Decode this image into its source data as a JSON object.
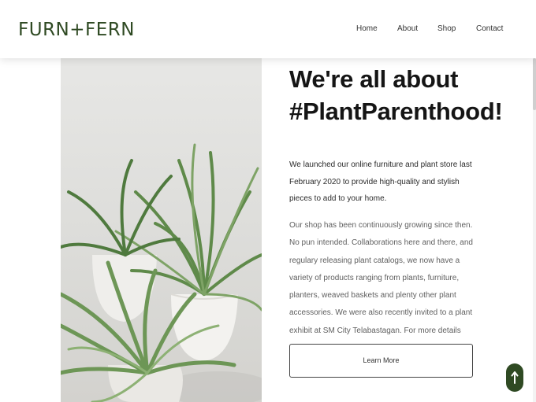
{
  "brand": {
    "logo_text": "FURN+FERN",
    "color": "#2f4a23"
  },
  "nav": {
    "items": [
      {
        "label": "Home"
      },
      {
        "label": "About"
      },
      {
        "label": "Shop"
      },
      {
        "label": "Contact"
      }
    ]
  },
  "about": {
    "heading_line1": "We're all about",
    "heading_line2": "#PlantParenthood!",
    "paragraph1": "We launched our online furniture and plant store last February 2020 to provide high-quality and stylish pieces to add to your home.",
    "paragraph2": "Our shop has been continuously growing since then. No pun intended. Collaborations here and there, and regulary releasing plant catalogs, we now have a variety of products ranging from plants, furniture, planters, weaved baskets and plenty other plant accessories. We were also recently invited to a plant exhibit at SM City Telabastagan. For more details about that, click below.",
    "cta_label": "Learn More"
  },
  "icons": {
    "back_to_top": "arrow-up-icon"
  },
  "colors": {
    "accent": "#2f4a23",
    "heading": "#151515",
    "body_text": "#5f5f5f"
  }
}
